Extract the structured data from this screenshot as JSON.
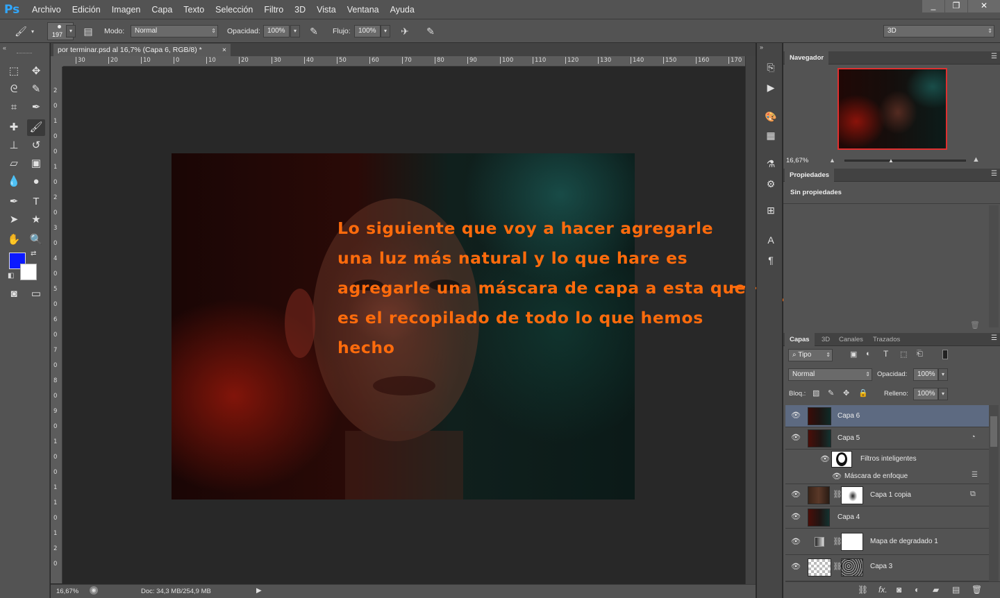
{
  "app": {
    "logo": "Ps"
  },
  "menu": [
    "Archivo",
    "Edición",
    "Imagen",
    "Capa",
    "Texto",
    "Selección",
    "Filtro",
    "3D",
    "Vista",
    "Ventana",
    "Ayuda"
  ],
  "window_controls": [
    "_",
    "❐",
    "✕"
  ],
  "options": {
    "brush_size": "197",
    "mode_label": "Modo:",
    "mode_value": "Normal",
    "opacity_label": "Opacidad:",
    "opacity_value": "100%",
    "flow_label": "Flujo:",
    "flow_value": "100%",
    "workspace_value": "3D"
  },
  "document": {
    "tab_title": "por terminar.psd al 16,7% (Capa 6, RGB/8) *",
    "close_glyph": "×",
    "zoom": "16,67%",
    "doc_size": "Doc: 34,3 MB/254,9 MB",
    "ruler_h": [
      "30",
      "20",
      "10",
      "0",
      "10",
      "20",
      "30",
      "40",
      "50",
      "60",
      "70",
      "80",
      "90",
      "100",
      "110",
      "120",
      "130",
      "140",
      "150",
      "160",
      "170"
    ],
    "ruler_v": [
      "2",
      "0",
      "1",
      "0",
      "0",
      "1",
      "0",
      "2",
      "0",
      "3",
      "0",
      "4",
      "0",
      "5",
      "0",
      "6",
      "0",
      "7",
      "0",
      "8",
      "0",
      "9",
      "0",
      "1",
      "0",
      "0",
      "1",
      "1",
      "0",
      "1",
      "2",
      "0"
    ]
  },
  "annotation": {
    "text": "Lo siguiente que voy a hacer agregarle una luz más natural y lo que hare es agregarle una máscara de capa a esta que es el recopilado de todo lo que hemos hecho",
    "color": "#ff6b0c"
  },
  "colors": {
    "foreground": "#0b19ff",
    "background": "#ffffff"
  },
  "navigator": {
    "title": "Navegador",
    "zoom": "16,67%"
  },
  "properties": {
    "title": "Propiedades",
    "content": "Sin propiedades"
  },
  "layers_panel": {
    "tabs": [
      "Capas",
      "3D",
      "Canales",
      "Trazados"
    ],
    "filter_value": "Tipo",
    "blend_mode": "Normal",
    "opacity_label": "Opacidad:",
    "opacity_value": "100%",
    "lock_label": "Bloq.:",
    "fill_label": "Relleno:",
    "fill_value": "100%",
    "layers": [
      {
        "name": "Capa 6",
        "selected": true
      },
      {
        "name": "Capa 5"
      },
      {
        "name": "Filtros inteligentes"
      },
      {
        "name": "Máscara de enfoque"
      },
      {
        "name": "Capa 1 copia"
      },
      {
        "name": "Capa 4"
      },
      {
        "name": "Mapa de degradado 1"
      },
      {
        "name": "Capa 3"
      }
    ]
  },
  "icons": {
    "menu": "☰",
    "eye": "👁",
    "chain": "⛓",
    "search": "⌕",
    "dropdown": "▾",
    "collapse": "«",
    "expand": "»",
    "trash": "🗑"
  }
}
